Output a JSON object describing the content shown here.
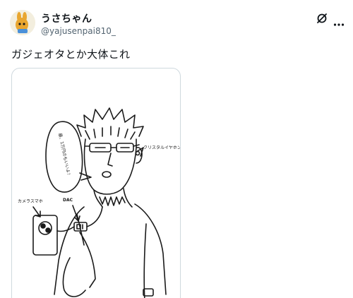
{
  "post": {
    "display_name": "うさちゃん",
    "handle": "@yajusenpai810_",
    "text": "ガジェオタとか大体これ"
  },
  "media": {
    "labels": {
      "earphone": "クリスタルイヤホン",
      "phone": "カメラスマホ",
      "dac": "DAC"
    },
    "speech": "最、1万円のもいいよ！"
  },
  "icons": {
    "grok": "grok-icon",
    "more": "more-icon"
  },
  "colors": {
    "text": "#0f1419",
    "secondary": "#536471",
    "border": "#cfd9de"
  }
}
